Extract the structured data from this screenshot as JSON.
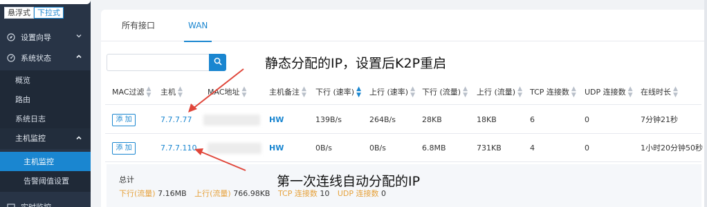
{
  "sidebar": {
    "mode_toggle": [
      "悬浮式",
      "下拉式"
    ],
    "groups": [
      {
        "label": "设置向导",
        "icon": "compass-icon",
        "expanded": false
      },
      {
        "label": "系统状态",
        "icon": "dashboard-icon",
        "expanded": true
      }
    ],
    "status_items": [
      "概览",
      "路由",
      "系统日志"
    ],
    "host_group": {
      "label": "主机监控",
      "expanded": true
    },
    "host_items": [
      "主机监控",
      "告警阈值设置"
    ],
    "bottom_label": "实时监控"
  },
  "tabs": [
    "所有接口",
    "WAN"
  ],
  "active_tab": "WAN",
  "search": {
    "value": "",
    "icon": "search-icon"
  },
  "table": {
    "headers": [
      "MAC过滤",
      "主机",
      "MAC地址",
      "主机备注",
      "下行 (速率)",
      "上行 (速率)",
      "下行 (流量)",
      "上行 (流量)",
      "TCP 连接数",
      "UDP 连接数",
      "在线时长"
    ],
    "sorted_column": "下行 (速率)",
    "add_label": "添 加",
    "rows": [
      {
        "host": "7.7.7.77",
        "remark": "HW",
        "down_rate": "139B/s",
        "up_rate": "264B/s",
        "down_traffic": "28KB",
        "up_traffic": "18KB",
        "tcp": "6",
        "udp": "0",
        "online": "7分钟21秒"
      },
      {
        "host": "7.7.7.110",
        "remark": "HW",
        "down_rate": "0B/s",
        "up_rate": "0B/s",
        "down_traffic": "6.8MB",
        "up_traffic": "731KB",
        "tcp": "4",
        "udp": "0",
        "online": "1小时20分钟50秒"
      }
    ]
  },
  "summary": {
    "title": "总计",
    "items": [
      {
        "label": "下行(流量)",
        "value": "7.16MB"
      },
      {
        "label": "上行(流量)",
        "value": "766.98KB"
      },
      {
        "label": "TCP 连接数",
        "value": "10"
      },
      {
        "label": "UDP 连接数",
        "value": "0"
      }
    ]
  },
  "annotations": {
    "top": "静态分配的IP，设置后K2P重启",
    "bottom": "第一次连线自动分配的IP",
    "arrow_color": "#e0463a"
  },
  "colors": {
    "accent": "#1a86d0",
    "sidebar_bg": "#283446",
    "summary_key": "#e6a23c"
  }
}
